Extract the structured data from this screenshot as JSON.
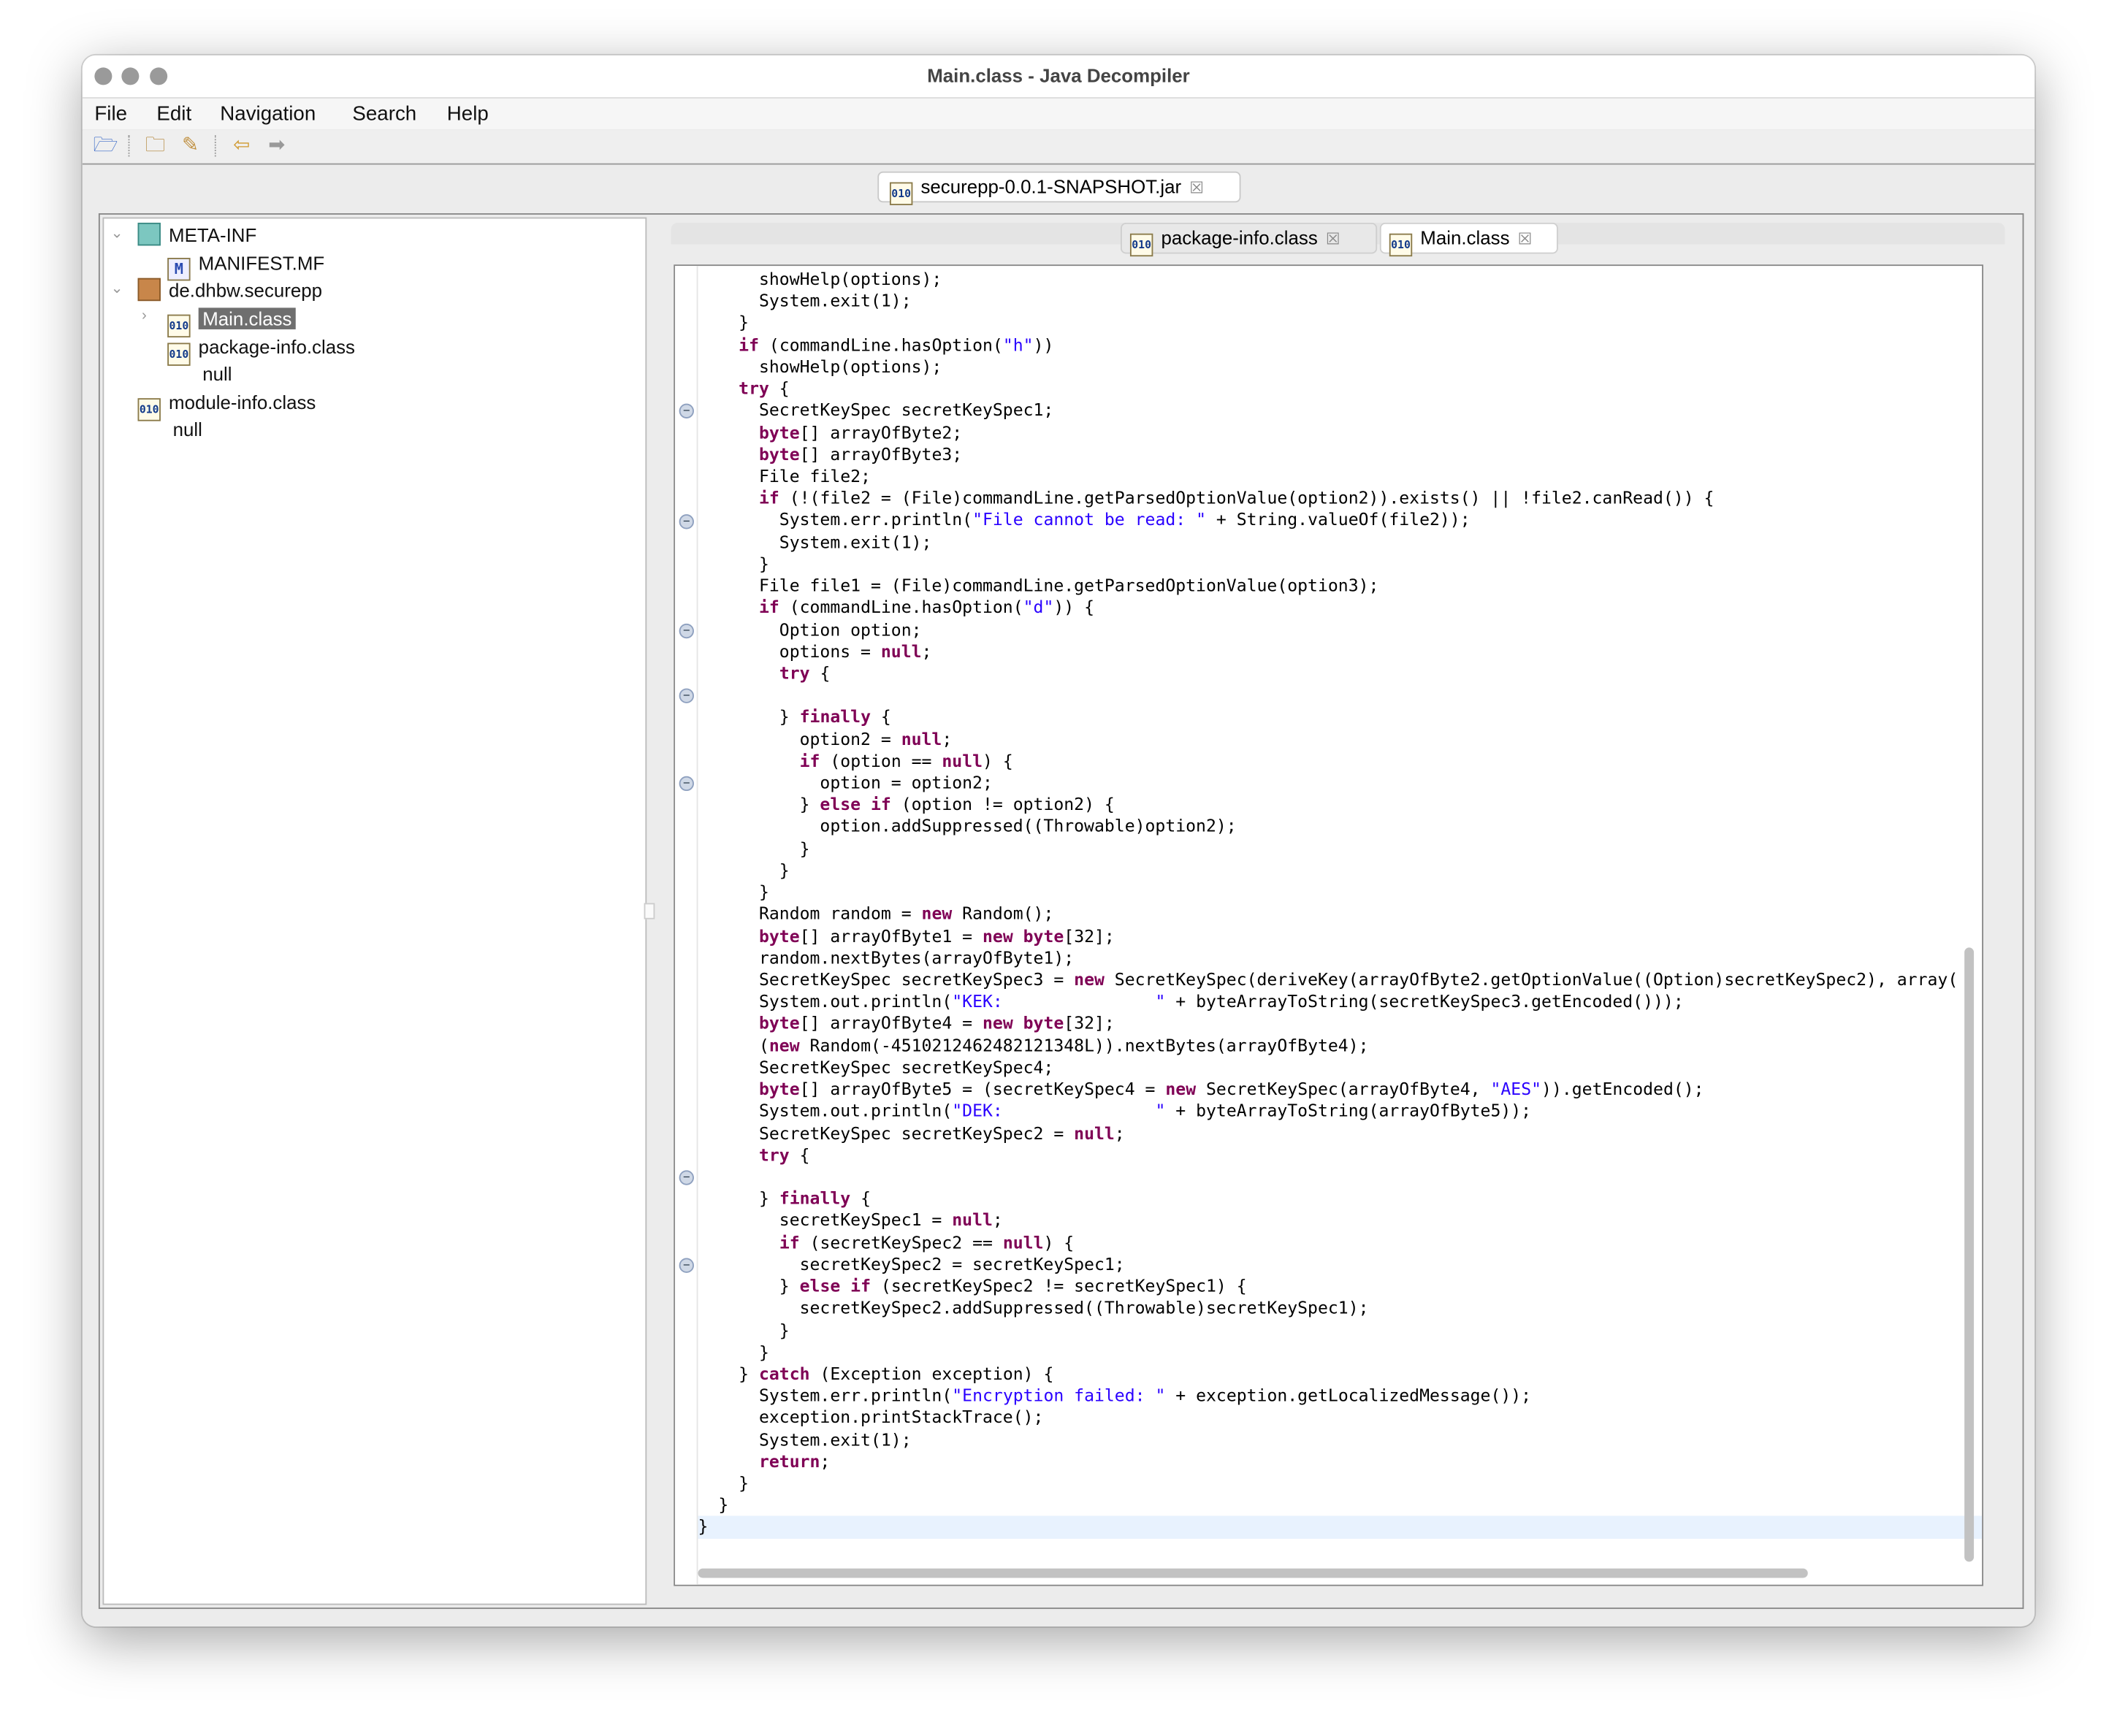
{
  "window": {
    "title": "Main.class - Java Decompiler"
  },
  "menu": [
    "File",
    "Edit",
    "Navigation",
    "Search",
    "Help"
  ],
  "toolbar": {
    "icons": [
      "open-file-icon",
      "open-type-icon",
      "search-icon",
      "back-arrow-icon",
      "forward-arrow-icon"
    ]
  },
  "jar_tab": {
    "label": "securepp-0.0.1-SNAPSHOT.jar",
    "close": "☒"
  },
  "tree": [
    {
      "label": "META-INF",
      "icon": "package-icon",
      "expanded": true
    },
    {
      "label": "MANIFEST.MF",
      "icon": "manifest-icon"
    },
    {
      "label": "de.dhbw.securepp",
      "icon": "package-icon",
      "expanded": true
    },
    {
      "label": "Main.class",
      "icon": "class-file-icon",
      "selected": true,
      "expanded": false
    },
    {
      "label": "package-info.class",
      "icon": "class-file-icon"
    },
    {
      "label": "null"
    },
    {
      "label": "module-info.class",
      "icon": "class-file-icon"
    },
    {
      "label": "null"
    }
  ],
  "editor_tabs": [
    {
      "label": "package-info.class",
      "close": "☒",
      "active": false
    },
    {
      "label": "Main.class",
      "close": "☒",
      "active": true
    }
  ],
  "colors": {
    "keyword": "#7f0055",
    "string": "#2a00ff",
    "selection": "#6f6f6f",
    "current_line": "#e8f2fe"
  },
  "code": {
    "fold_lines": [
      6,
      11,
      16,
      19,
      23,
      41,
      45
    ],
    "current_line": 57,
    "lines": [
      [
        [
          "      showHelp(options);",
          ""
        ]
      ],
      [
        [
          "      System.exit(1);",
          ""
        ]
      ],
      [
        [
          "    }",
          ""
        ]
      ],
      [
        [
          "    ",
          ""
        ],
        [
          "if",
          "k"
        ],
        [
          " (commandLine.hasOption(",
          ""
        ],
        [
          "\"h\"",
          "s"
        ],
        [
          "))",
          ""
        ]
      ],
      [
        [
          "      showHelp(options);",
          ""
        ]
      ],
      [
        [
          "    ",
          ""
        ],
        [
          "try",
          "k"
        ],
        [
          " {",
          ""
        ]
      ],
      [
        [
          "      SecretKeySpec secretKeySpec1;",
          ""
        ]
      ],
      [
        [
          "      ",
          ""
        ],
        [
          "byte",
          "k"
        ],
        [
          "[] arrayOfByte2;",
          ""
        ]
      ],
      [
        [
          "      ",
          ""
        ],
        [
          "byte",
          "k"
        ],
        [
          "[] arrayOfByte3;",
          ""
        ]
      ],
      [
        [
          "      File file2;",
          ""
        ]
      ],
      [
        [
          "      ",
          ""
        ],
        [
          "if",
          "k"
        ],
        [
          " (!(file2 = (File)commandLine.getParsedOptionValue(option2)).exists() || !file2.canRead()) {",
          ""
        ]
      ],
      [
        [
          "        System.err.println(",
          ""
        ],
        [
          "\"File cannot be read: \"",
          "s"
        ],
        [
          " + String.valueOf(file2));",
          ""
        ]
      ],
      [
        [
          "        System.exit(1);",
          ""
        ]
      ],
      [
        [
          "      }",
          ""
        ]
      ],
      [
        [
          "      File file1 = (File)commandLine.getParsedOptionValue(option3);",
          ""
        ]
      ],
      [
        [
          "      ",
          ""
        ],
        [
          "if",
          "k"
        ],
        [
          " (commandLine.hasOption(",
          ""
        ],
        [
          "\"d\"",
          "s"
        ],
        [
          ")) {",
          ""
        ]
      ],
      [
        [
          "        Option option;",
          ""
        ]
      ],
      [
        [
          "        options = ",
          ""
        ],
        [
          "null",
          "k"
        ],
        [
          ";",
          ""
        ]
      ],
      [
        [
          "        ",
          ""
        ],
        [
          "try",
          "k"
        ],
        [
          " {",
          ""
        ]
      ],
      [
        [
          "",
          ""
        ]
      ],
      [
        [
          "        } ",
          ""
        ],
        [
          "finally",
          "k"
        ],
        [
          " {",
          ""
        ]
      ],
      [
        [
          "          option2 = ",
          ""
        ],
        [
          "null",
          "k"
        ],
        [
          ";",
          ""
        ]
      ],
      [
        [
          "          ",
          ""
        ],
        [
          "if",
          "k"
        ],
        [
          " (option == ",
          ""
        ],
        [
          "null",
          "k"
        ],
        [
          ") {",
          ""
        ]
      ],
      [
        [
          "            option = option2;",
          ""
        ]
      ],
      [
        [
          "          } ",
          ""
        ],
        [
          "else if",
          "k"
        ],
        [
          " (option != option2) {",
          ""
        ]
      ],
      [
        [
          "            option.addSuppressed((Throwable)option2);",
          ""
        ]
      ],
      [
        [
          "          }",
          ""
        ]
      ],
      [
        [
          "        }",
          ""
        ]
      ],
      [
        [
          "      }",
          ""
        ]
      ],
      [
        [
          "      Random random = ",
          ""
        ],
        [
          "new",
          "k"
        ],
        [
          " Random();",
          ""
        ]
      ],
      [
        [
          "      ",
          ""
        ],
        [
          "byte",
          "k"
        ],
        [
          "[] arrayOfByte1 = ",
          ""
        ],
        [
          "new byte",
          "k"
        ],
        [
          "[32];",
          ""
        ]
      ],
      [
        [
          "      random.nextBytes(arrayOfByte1);",
          ""
        ]
      ],
      [
        [
          "      SecretKeySpec secretKeySpec3 = ",
          ""
        ],
        [
          "new",
          "k"
        ],
        [
          " SecretKeySpec(deriveKey(arrayOfByte2.getOptionValue((Option)secretKeySpec2), array(",
          ""
        ]
      ],
      [
        [
          "      System.out.println(",
          ""
        ],
        [
          "\"KEK:               \"",
          "s"
        ],
        [
          " + byteArrayToString(secretKeySpec3.getEncoded()));",
          ""
        ]
      ],
      [
        [
          "      ",
          ""
        ],
        [
          "byte",
          "k"
        ],
        [
          "[] arrayOfByte4 = ",
          ""
        ],
        [
          "new byte",
          "k"
        ],
        [
          "[32];",
          ""
        ]
      ],
      [
        [
          "      (",
          ""
        ],
        [
          "new",
          "k"
        ],
        [
          " Random(-4510212462482121348L)).nextBytes(arrayOfByte4);",
          ""
        ]
      ],
      [
        [
          "      SecretKeySpec secretKeySpec4;",
          ""
        ]
      ],
      [
        [
          "      ",
          ""
        ],
        [
          "byte",
          "k"
        ],
        [
          "[] arrayOfByte5 = (secretKeySpec4 = ",
          ""
        ],
        [
          "new",
          "k"
        ],
        [
          " SecretKeySpec(arrayOfByte4, ",
          ""
        ],
        [
          "\"AES\"",
          "s"
        ],
        [
          ")).getEncoded();",
          ""
        ]
      ],
      [
        [
          "      System.out.println(",
          ""
        ],
        [
          "\"DEK:               \"",
          "s"
        ],
        [
          " + byteArrayToString(arrayOfByte5));",
          ""
        ]
      ],
      [
        [
          "      SecretKeySpec secretKeySpec2 = ",
          ""
        ],
        [
          "null",
          "k"
        ],
        [
          ";",
          ""
        ]
      ],
      [
        [
          "      ",
          ""
        ],
        [
          "try",
          "k"
        ],
        [
          " {",
          ""
        ]
      ],
      [
        [
          "",
          ""
        ]
      ],
      [
        [
          "      } ",
          ""
        ],
        [
          "finally",
          "k"
        ],
        [
          " {",
          ""
        ]
      ],
      [
        [
          "        secretKeySpec1 = ",
          ""
        ],
        [
          "null",
          "k"
        ],
        [
          ";",
          ""
        ]
      ],
      [
        [
          "        ",
          ""
        ],
        [
          "if",
          "k"
        ],
        [
          " (secretKeySpec2 == ",
          ""
        ],
        [
          "null",
          "k"
        ],
        [
          ") {",
          ""
        ]
      ],
      [
        [
          "          secretKeySpec2 = secretKeySpec1;",
          ""
        ]
      ],
      [
        [
          "        } ",
          ""
        ],
        [
          "else if",
          "k"
        ],
        [
          " (secretKeySpec2 != secretKeySpec1) {",
          ""
        ]
      ],
      [
        [
          "          secretKeySpec2.addSuppressed((Throwable)secretKeySpec1);",
          ""
        ]
      ],
      [
        [
          "        }",
          ""
        ]
      ],
      [
        [
          "      }",
          ""
        ]
      ],
      [
        [
          "    } ",
          ""
        ],
        [
          "catch",
          "k"
        ],
        [
          " (Exception exception) {",
          ""
        ]
      ],
      [
        [
          "      System.err.println(",
          ""
        ],
        [
          "\"Encryption failed: \"",
          "s"
        ],
        [
          " + exception.getLocalizedMessage());",
          ""
        ]
      ],
      [
        [
          "      exception.printStackTrace();",
          ""
        ]
      ],
      [
        [
          "      System.exit(1);",
          ""
        ]
      ],
      [
        [
          "      ",
          ""
        ],
        [
          "return",
          "k"
        ],
        [
          ";",
          ""
        ]
      ],
      [
        [
          "    }",
          ""
        ]
      ],
      [
        [
          "  }",
          ""
        ]
      ],
      [
        [
          "}",
          ""
        ]
      ]
    ]
  }
}
